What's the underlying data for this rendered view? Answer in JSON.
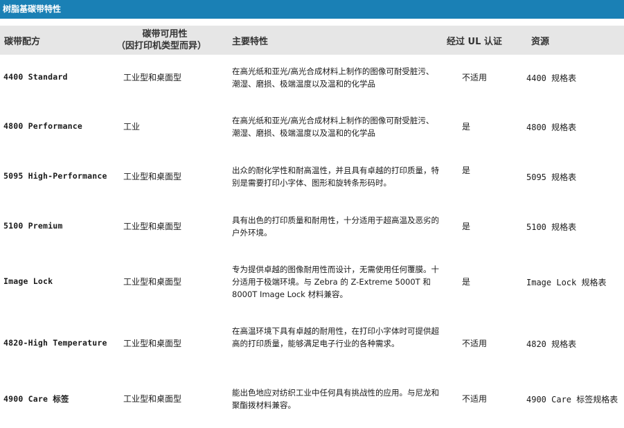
{
  "title": "树脂基碳带特性",
  "headers": {
    "formula": "碳带配方",
    "usage_line1": "碳带可用性",
    "usage_line2": "（因打印机类型而异）",
    "features": "主要特性",
    "ul": "经过 UL 认证",
    "resources": "资源"
  },
  "rows": [
    {
      "name": "4400 Standard",
      "usage": "工业型和桌面型",
      "desc": "在高光纸和亚光/高光合成材料上制作的图像可耐受脏污、潮湿、磨损、极端温度以及温和的化学品",
      "ul": "不适用",
      "resource": "4400 规格表"
    },
    {
      "name": "4800 Performance",
      "usage": "工业",
      "desc": "在高光纸和亚光/高光合成材料上制作的图像可耐受脏污、潮湿、磨损、极端温度以及温和的化学品",
      "ul": "是",
      "resource": "4800 规格表"
    },
    {
      "name": "5095 High-Performance",
      "usage": "工业型和桌面型",
      "desc": "出众的耐化学性和耐高温性，并且具有卓越的打印质量，特别是需要打印小字体、图形和旋转条形码时。",
      "ul": "是",
      "resource": "5095 规格表"
    },
    {
      "name": "5100 Premium",
      "usage": "工业型和桌面型",
      "desc": "具有出色的打印质量和耐用性，十分适用于超高温及恶劣的户外环境。",
      "ul": "是",
      "resource": "5100 规格表"
    },
    {
      "name": "Image Lock",
      "usage": "工业型和桌面型",
      "desc": "专为提供卓越的图像耐用性而设计，无需使用任何覆膜。十分适用于极端环境。与 Zebra 的 Z-Extreme 5000T 和 8000T Image Lock 材料兼容。",
      "ul": "是",
      "resource": "Image Lock 规格表"
    },
    {
      "name": "4820-High Temperature",
      "usage": "工业型和桌面型",
      "desc": "在高温环境下具有卓越的耐用性，在打印小字体时可提供超高的打印质量，能够满足电子行业的各种需求。",
      "ul": "不适用",
      "resource": "4820 规格表"
    },
    {
      "name": "4900 Care 标签",
      "usage": "工业型和桌面型",
      "desc": "能出色地应对纺织工业中任何具有挑战性的应用。与尼龙和聚酯拨材料兼容。",
      "ul": "不适用",
      "resource": "4900 Care 标签规格表"
    }
  ]
}
